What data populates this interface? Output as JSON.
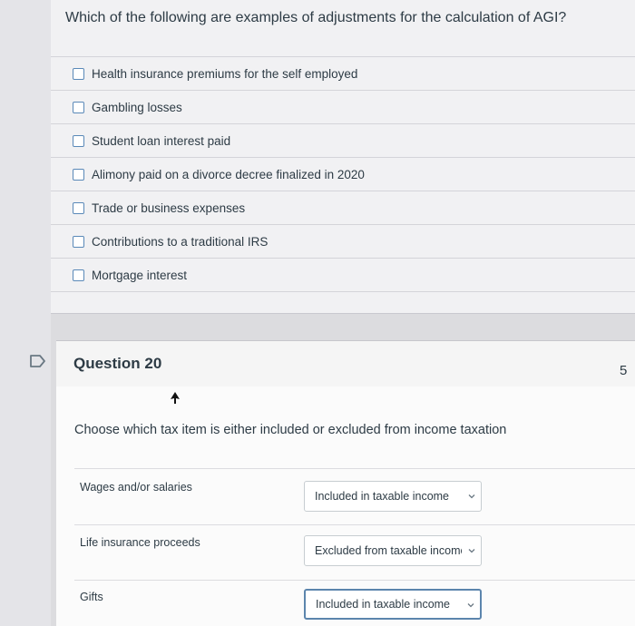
{
  "question19": {
    "text": "Which of the following are examples of adjustments for the calculation of AGI?",
    "options": [
      "Health insurance premiums for the self employed",
      "Gambling losses",
      "Student loan interest paid",
      "Alimony paid on a divorce decree finalized in 2020",
      "Trade or business expenses",
      "Contributions to a traditional IRS",
      "Mortgage interest"
    ]
  },
  "question20": {
    "title": "Question 20",
    "points": "5",
    "prompt": "Choose which tax item is either included or excluded from income taxation",
    "items": [
      {
        "label": "Wages and/or salaries",
        "selected": "Included in taxable income"
      },
      {
        "label": "Life insurance proceeds",
        "selected": "Excluded from taxable income"
      },
      {
        "label": "Gifts",
        "selected": "Included in taxable income"
      }
    ]
  },
  "colors": {
    "checkbox_border": "#5a89b8",
    "focus_border": "#5c85ad",
    "text": "#2d3b45"
  }
}
